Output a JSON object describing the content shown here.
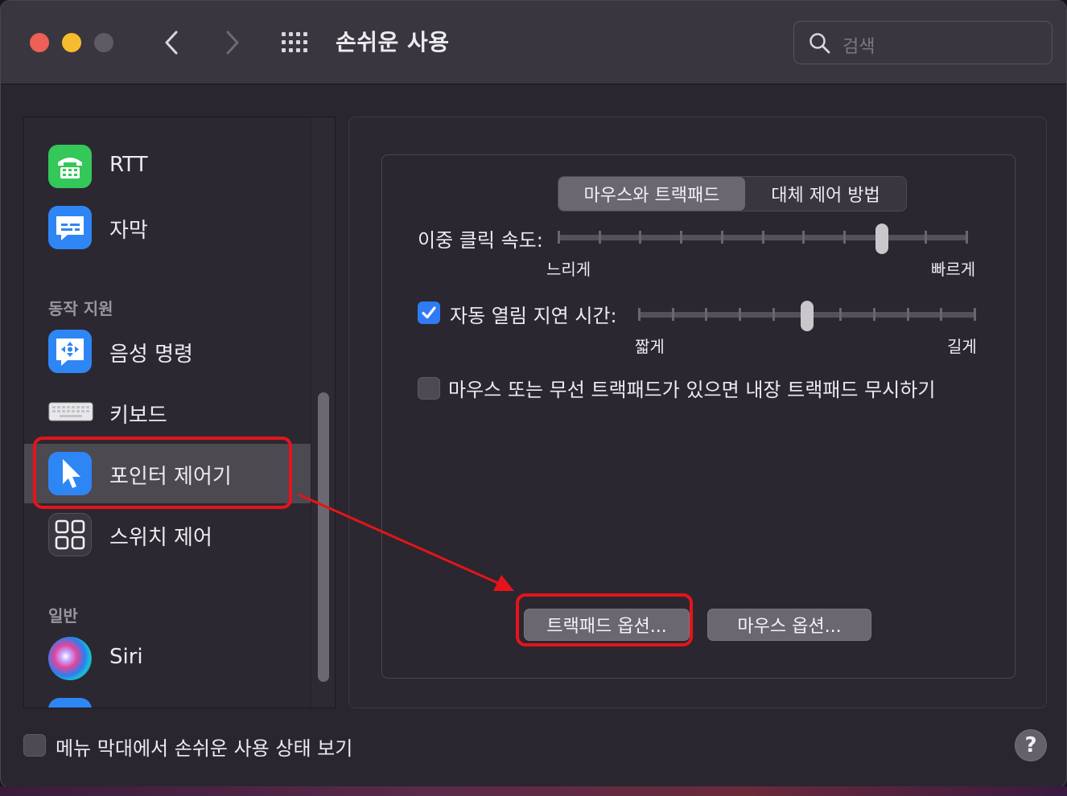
{
  "window": {
    "title": "손쉬운 사용"
  },
  "search": {
    "placeholder": "검색"
  },
  "sidebar": {
    "items_top": [
      {
        "label": "RTT",
        "icon": "rtt-phone-icon"
      },
      {
        "label": "자막",
        "icon": "captions-icon"
      }
    ],
    "section_motor": "동작 지원",
    "items_motor": [
      {
        "label": "음성 명령",
        "icon": "voice-control-icon"
      },
      {
        "label": "키보드",
        "icon": "keyboard-icon"
      },
      {
        "label": "포인터 제어기",
        "icon": "pointer-icon",
        "selected": true
      },
      {
        "label": "스위치 제어",
        "icon": "switch-control-icon"
      }
    ],
    "section_general": "일반",
    "items_general": [
      {
        "label": "Siri",
        "icon": "siri-icon"
      }
    ]
  },
  "tabs": {
    "active": "마우스와 트랙패드",
    "other": "대체 제어 방법"
  },
  "double_click": {
    "label": "이중 클릭 속도:",
    "min_label": "느리게",
    "max_label": "빠르게",
    "value_fraction": 0.79
  },
  "spring_loading": {
    "label": "자동 열림 지연 시간:",
    "checked": true,
    "min_label": "짧게",
    "max_label": "길게",
    "value_fraction": 0.5
  },
  "ignore_trackpad": {
    "label": "마우스 또는 무선 트랙패드가 있으면 내장 트랙패드 무시하기",
    "checked": false
  },
  "buttons": {
    "trackpad_options": "트랙패드 옵션...",
    "mouse_options": "마우스 옵션..."
  },
  "footer": {
    "show_status_label": "메뉴 막대에서 손쉬운 사용 상태 보기",
    "help": "?"
  },
  "colors": {
    "accent": "#2f7bf6",
    "highlight": "#e5141b"
  }
}
